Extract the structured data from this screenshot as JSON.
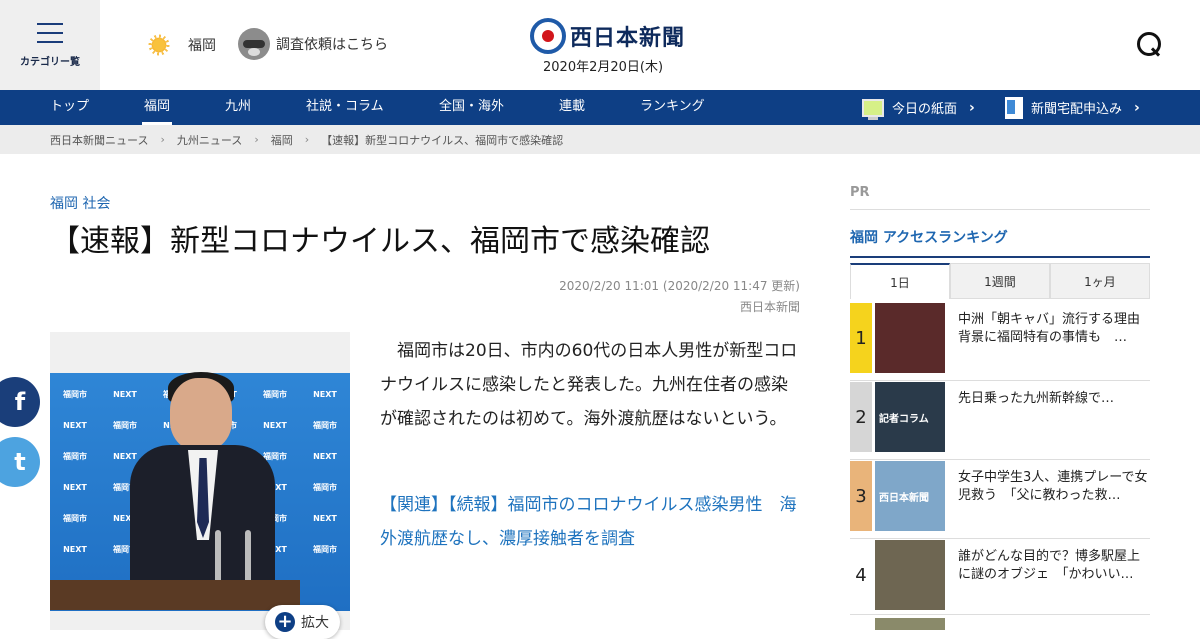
{
  "header": {
    "menu_label": "カテゴリー覧",
    "weather_city": "福岡",
    "request_text": "調査依頼はこちら",
    "logo_text": "西日本新聞",
    "date": "2020年2月20日(木)"
  },
  "nav": {
    "items": [
      "トップ",
      "福岡",
      "九州",
      "社説・コラム",
      "全国・海外",
      "連載",
      "ランキング"
    ],
    "active": "福岡",
    "today_paper": "今日の紙面",
    "subscribe": "新聞宅配申込み"
  },
  "breadcrumb": [
    "西日本新聞ニュース",
    "九州ニュース",
    "福岡",
    "【速報】新型コロナウイルス、福岡市で感染確認"
  ],
  "article": {
    "categories": [
      "福岡",
      "社会"
    ],
    "title": "【速報】新型コロナウイルス、福岡市で感染確認",
    "published": "2020/2/20 11:01 (2020/2/20 11:47 更新)",
    "source": "西日本新聞",
    "body": "福岡市は20日、市内の60代の日本人男性が新型コロナウイルスに感染したと発表した。九州在住者の感染が確認されたのは初めて。海外渡航歴はないという。",
    "related": "【関連】【続報】福岡市のコロナウイルス感染男性　海外渡航歴なし、濃厚接触者を調査",
    "enlarge_label": "拡大",
    "photo_backdrop_labels": [
      "福岡市",
      "NEXT"
    ]
  },
  "social": {
    "facebook": "f",
    "twitter": "t"
  },
  "sidebar": {
    "pr_label": "PR",
    "ranking_title": "福岡 アクセスランキング",
    "tabs": [
      "1日",
      "1週間",
      "1ヶ月"
    ],
    "active_tab": "1日",
    "items": [
      {
        "rank": "1",
        "text": "中洲「朝キャバ」流行する理由　背景に福岡特有の事情も　…",
        "rank_color": "#f5d31d",
        "thumb_color": "#5a2a2a"
      },
      {
        "rank": "2",
        "text": "先日乗った九州新幹線で…",
        "rank_color": "#d6d6d6",
        "thumb_color": "#2a3a4a",
        "thumb_label": "記者コラム"
      },
      {
        "rank": "3",
        "text": "女子中学生3人、連携プレーで女児救う　「父に教わった救…",
        "rank_color": "#e9b47a",
        "thumb_color": "#7fa7c9",
        "thumb_label": "西日本新聞"
      },
      {
        "rank": "4",
        "text": "誰がどんな目的で？博多駅屋上に謎のオブジェ　「かわいい…",
        "rank_color": "#ffffff",
        "thumb_color": "#6e6652"
      }
    ]
  }
}
